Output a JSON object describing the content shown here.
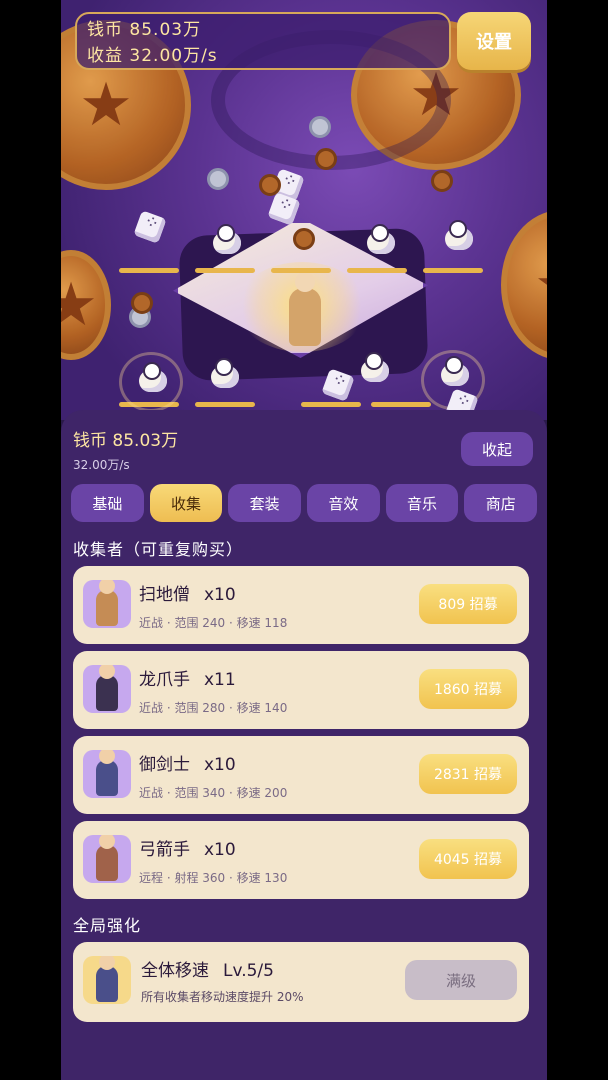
{
  "hud": {
    "coins_line": "钱币 85.03万",
    "income_line": "收益 32.00万/s",
    "settings_label": "设置"
  },
  "panel": {
    "coins": "钱币 85.03万",
    "rate": "32.00万/s",
    "collapse_label": "收起",
    "tabs": [
      {
        "label": "基础",
        "active": false
      },
      {
        "label": "收集",
        "active": true
      },
      {
        "label": "套装",
        "active": false
      },
      {
        "label": "音效",
        "active": false
      },
      {
        "label": "音乐",
        "active": false
      },
      {
        "label": "商店",
        "active": false
      }
    ],
    "collectors_title": "收集者（可重复购买）",
    "collectors": [
      {
        "name": "扫地僧",
        "count": "x10",
        "stats": "近战 · 范围 240 · 移速 118",
        "recruit": "809 招募",
        "icon": "monk-icon",
        "color": "#c58c55"
      },
      {
        "name": "龙爪手",
        "count": "x11",
        "stats": "近战 · 范围 280 · 移速 140",
        "recruit": "1860 招募",
        "icon": "dragon-claw-fighter-icon",
        "color": "#3b3150"
      },
      {
        "name": "御剑士",
        "count": "x10",
        "stats": "近战 · 范围 340 · 移速 200",
        "recruit": "2831 招募",
        "icon": "swordsman-icon",
        "color": "#4a4f8a"
      },
      {
        "name": "弓箭手",
        "count": "x10",
        "stats": "远程 · 射程 360 · 移速 130",
        "recruit": "4045 招募",
        "icon": "archer-icon",
        "color": "#a0624a"
      }
    ],
    "global_title": "全局强化",
    "global_upgrade": {
      "name": "全体移速",
      "level": "Lv.5/5",
      "desc": "所有收集者移动速度提升 20%",
      "button": "满级",
      "icon": "speed-upgrade-icon"
    }
  },
  "colors": {
    "accent_gold": "#f1c34f",
    "panel_purple": "#3f2568",
    "tab_purple": "#6a44a6",
    "card_cream": "#f3e6cd"
  }
}
